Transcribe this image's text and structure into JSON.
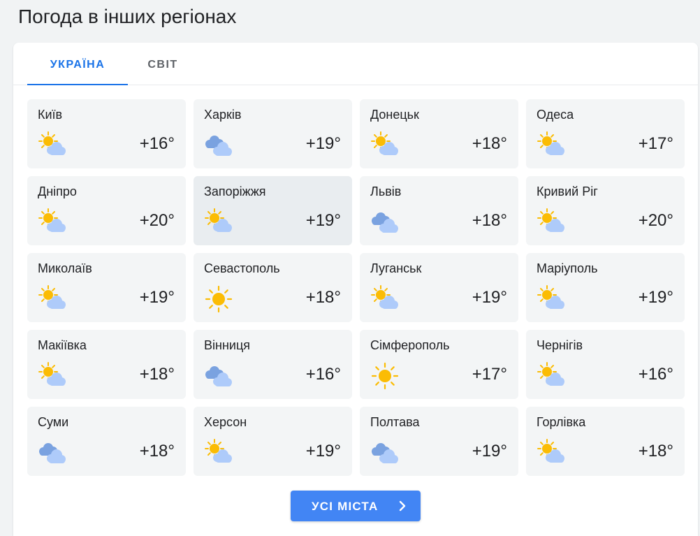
{
  "page": {
    "title": "Погода в інших регіонах"
  },
  "tabs": [
    {
      "label": "УКРАЇНА",
      "active": true
    },
    {
      "label": "СВІТ",
      "active": false
    }
  ],
  "colors": {
    "accent": "#1a73e8",
    "button": "#4285f4",
    "card": "#f3f5f6",
    "sun": "#fbbc04",
    "cloud": "#8ab4f8"
  },
  "cities": [
    {
      "name": "Київ",
      "temp": "+16°",
      "icon": "sun-cloud-icon"
    },
    {
      "name": "Харків",
      "temp": "+19°",
      "icon": "clouds-icon"
    },
    {
      "name": "Донецьк",
      "temp": "+18°",
      "icon": "sun-cloud-icon"
    },
    {
      "name": "Одеса",
      "temp": "+17°",
      "icon": "sun-cloud-icon"
    },
    {
      "name": "Дніпро",
      "temp": "+20°",
      "icon": "sun-cloud-icon"
    },
    {
      "name": "Запоріжжя",
      "temp": "+19°",
      "icon": "sun-cloud-icon"
    },
    {
      "name": "Львів",
      "temp": "+18°",
      "icon": "clouds-icon"
    },
    {
      "name": "Кривий Ріг",
      "temp": "+20°",
      "icon": "sun-cloud-icon"
    },
    {
      "name": "Миколаїв",
      "temp": "+19°",
      "icon": "sun-cloud-icon"
    },
    {
      "name": "Севастополь",
      "temp": "+18°",
      "icon": "sun-icon"
    },
    {
      "name": "Луганськ",
      "temp": "+19°",
      "icon": "sun-cloud-icon"
    },
    {
      "name": "Маріуполь",
      "temp": "+19°",
      "icon": "sun-cloud-icon"
    },
    {
      "name": "Макіївка",
      "temp": "+18°",
      "icon": "sun-cloud-icon"
    },
    {
      "name": "Вінниця",
      "temp": "+16°",
      "icon": "clouds-icon"
    },
    {
      "name": "Сімферополь",
      "temp": "+17°",
      "icon": "sun-icon"
    },
    {
      "name": "Чернігів",
      "temp": "+16°",
      "icon": "sun-cloud-icon"
    },
    {
      "name": "Суми",
      "temp": "+18°",
      "icon": "clouds-icon"
    },
    {
      "name": "Херсон",
      "temp": "+19°",
      "icon": "sun-cloud-icon"
    },
    {
      "name": "Полтава",
      "temp": "+19°",
      "icon": "clouds-icon"
    },
    {
      "name": "Горлівка",
      "temp": "+18°",
      "icon": "sun-cloud-icon"
    }
  ],
  "all_cities_button": {
    "label": "УСІ МІСТА",
    "icon": "chevron-right-icon"
  }
}
